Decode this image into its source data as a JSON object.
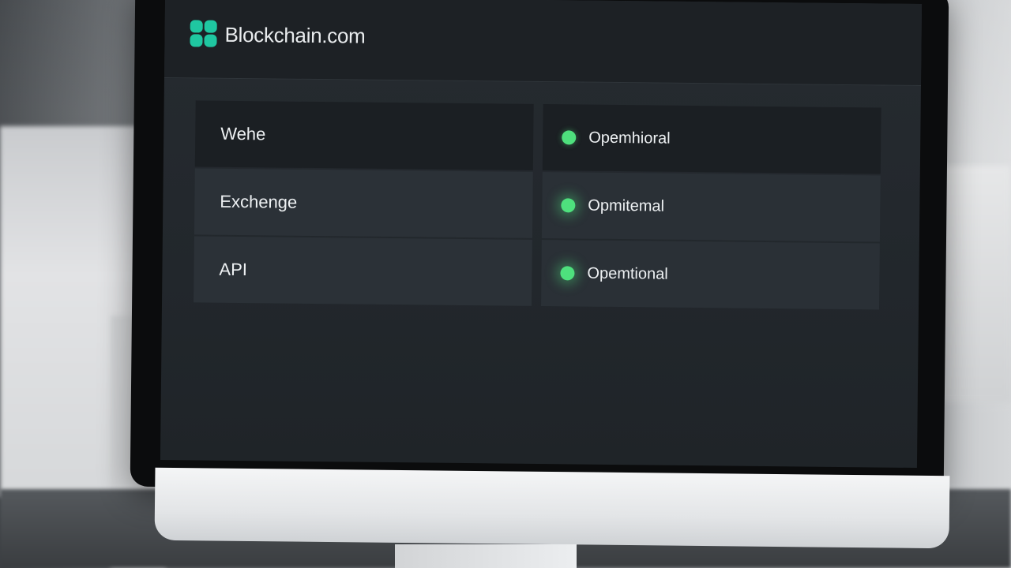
{
  "brand": {
    "name": "Blockchain.com",
    "logo_icon": "blockchain-logo-icon",
    "accent_color": "#1fc7a1"
  },
  "services": [
    {
      "name": "Wehe",
      "status": "Opemhioral"
    },
    {
      "name": "Exchenge",
      "status": "Opmitemal"
    },
    {
      "name": "API",
      "status": "Opemtional"
    }
  ],
  "status_color": "#4ee07d"
}
